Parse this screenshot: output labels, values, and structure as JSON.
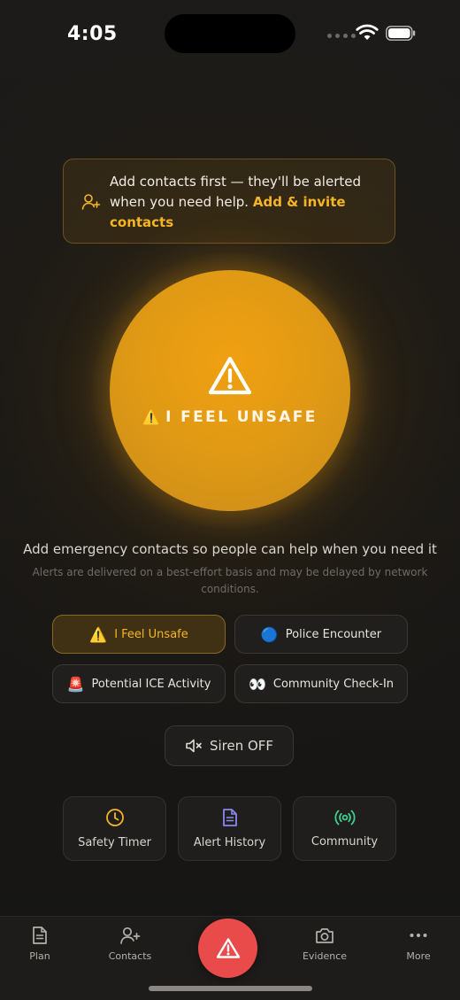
{
  "status_bar": {
    "time": "4:05"
  },
  "banner": {
    "text": "Add contacts first — they'll be alerted when you need help.",
    "link": "Add & invite contacts"
  },
  "panic_button": {
    "label": "I FEEL UNSAFE",
    "emoji": "⚠️"
  },
  "message": "Add emergency contacts so people can help when you need it",
  "disclaimer": "Alerts are delivered on a best-effort basis and may be delayed by network conditions.",
  "alert_types": [
    {
      "emoji": "⚠️",
      "label": "I Feel Unsafe",
      "selected": true
    },
    {
      "emoji": "🔵",
      "label": "Police Encounter",
      "selected": false
    },
    {
      "emoji": "🚨",
      "label": "Potential ICE Activity",
      "selected": false
    },
    {
      "emoji": "👀",
      "label": "Community Check-In",
      "selected": false
    }
  ],
  "siren": {
    "label": "Siren OFF"
  },
  "tools": [
    {
      "label": "Safety Timer",
      "icon": "clock-icon",
      "color": "#f5b526"
    },
    {
      "label": "Alert History",
      "icon": "document-icon",
      "color": "#8b87f0"
    },
    {
      "label": "Community",
      "icon": "broadcast-icon",
      "color": "#3fcf8e"
    }
  ],
  "tab_bar": {
    "items": [
      {
        "label": "Plan",
        "icon": "document-icon"
      },
      {
        "label": "Contacts",
        "icon": "add-contact-icon"
      },
      {
        "label": "Evidence",
        "icon": "camera-icon"
      },
      {
        "label": "More",
        "icon": "more-icon"
      }
    ],
    "sos_color": "#e94b4b"
  },
  "colors": {
    "accent": "#f5b526",
    "button": "#e19a14",
    "sos": "#e94b4b"
  }
}
